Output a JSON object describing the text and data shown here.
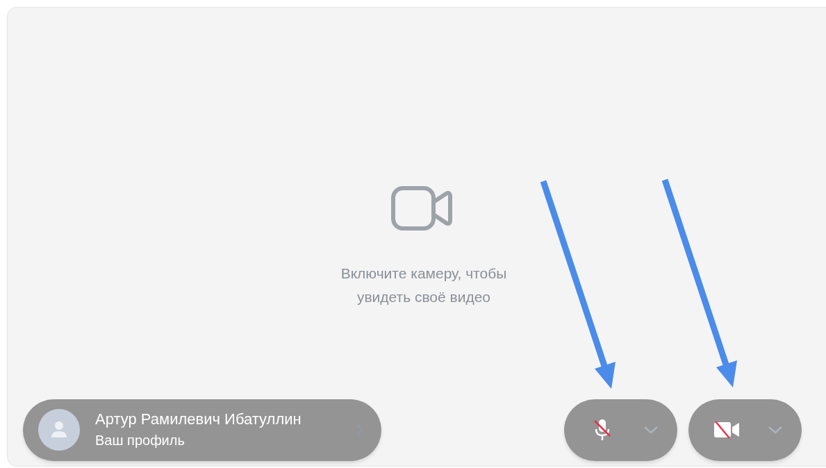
{
  "placeholder": {
    "message": "Включите камеру, чтобы увидеть своё видео"
  },
  "profile": {
    "name": "Артур Рамилевич Ибатуллин",
    "subtitle": "Ваш профиль"
  },
  "controls": [
    {
      "kind": "microphone",
      "muted": true
    },
    {
      "kind": "camera",
      "muted": true
    }
  ]
}
